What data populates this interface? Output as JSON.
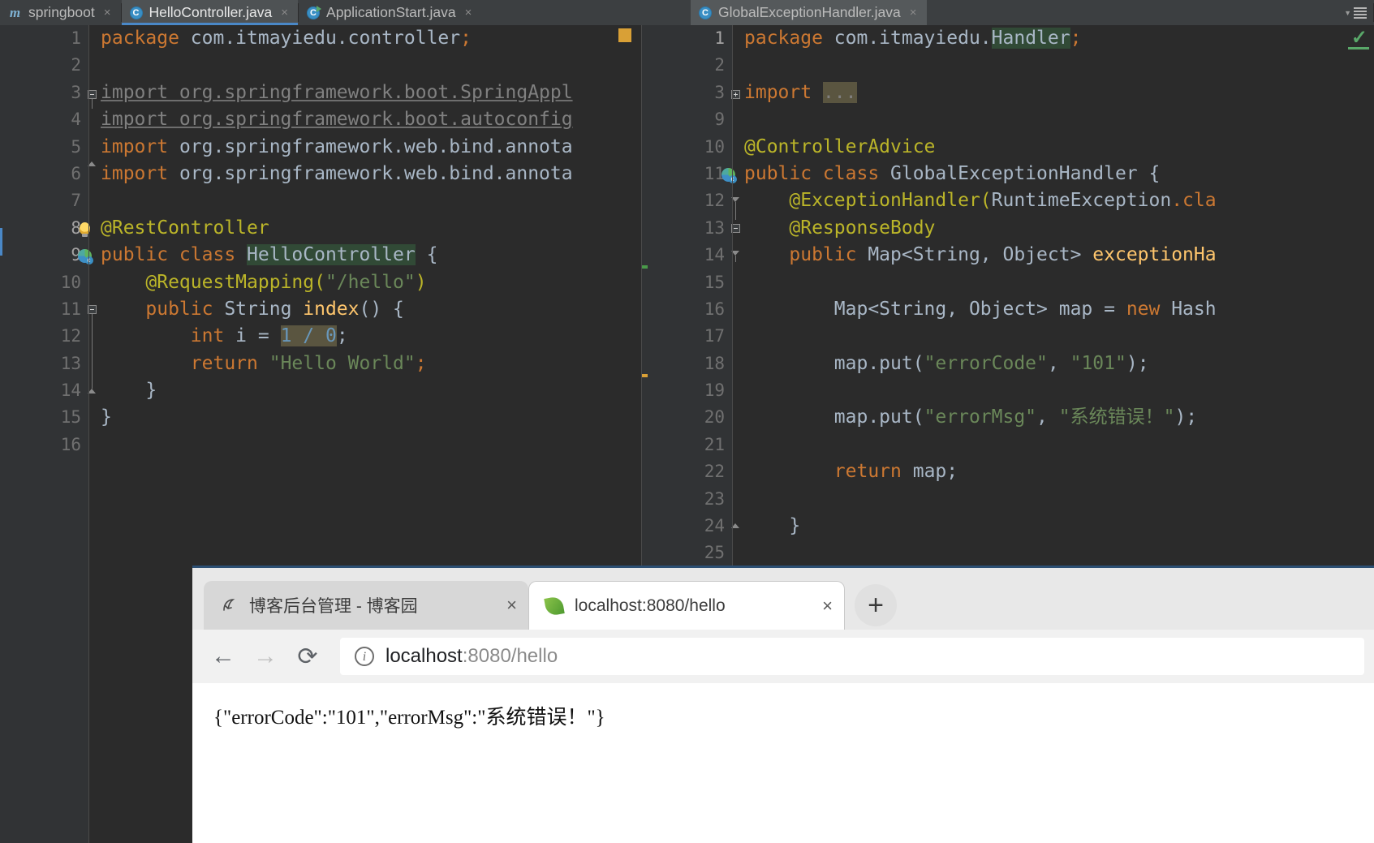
{
  "ide": {
    "tabs": [
      {
        "label": "springboot",
        "icon": "maven-module-icon",
        "state": "normal"
      },
      {
        "label": "HelloController.java",
        "icon": "java-class-icon",
        "state": "active"
      },
      {
        "label": "ApplicationStart.java",
        "icon": "java-runnable-class-icon",
        "state": "normal"
      },
      {
        "label": "GlobalExceptionHandler.java",
        "icon": "java-class-icon",
        "state": "focused"
      }
    ],
    "tab_close_label": "×",
    "tabbar_overflow_icon": "tab-list-dropdown-icon",
    "left_editor": {
      "file": "HelloController.java",
      "line_numbers": [
        "1",
        "2",
        "3",
        "4",
        "5",
        "6",
        "7",
        "8",
        "9",
        "10",
        "11",
        "12",
        "13",
        "14",
        "15",
        "16"
      ],
      "lines": [
        {
          "n": "1",
          "tokens": [
            {
              "t": "package",
              "c": "k"
            },
            {
              "t": " com.itmayiedu.controller",
              "c": "id"
            },
            {
              "t": ";",
              "c": "k"
            }
          ]
        },
        {
          "n": "2",
          "tokens": []
        },
        {
          "n": "3",
          "tokens": [
            {
              "t": "import org.springframework.boot.SpringAppl",
              "c": "unused"
            }
          ]
        },
        {
          "n": "4",
          "tokens": [
            {
              "t": "import org.springframework.boot.autoconfig",
              "c": "unused"
            }
          ]
        },
        {
          "n": "5",
          "tokens": [
            {
              "t": "import",
              "c": "k"
            },
            {
              "t": " org.springframework.web.bind.annota",
              "c": "id"
            }
          ]
        },
        {
          "n": "6",
          "tokens": [
            {
              "t": "import",
              "c": "k"
            },
            {
              "t": " org.springframework.web.bind.annota",
              "c": "id"
            }
          ]
        },
        {
          "n": "7",
          "tokens": []
        },
        {
          "n": "8",
          "tokens": [
            {
              "t": "@RestController",
              "c": "an"
            }
          ]
        },
        {
          "n": "9",
          "tokens": [
            {
              "t": "public class ",
              "c": "k"
            },
            {
              "t": "HelloController",
              "c": "id sel-green"
            },
            {
              "t": " {",
              "c": "id"
            }
          ]
        },
        {
          "n": "10",
          "tokens": [
            {
              "t": "    @RequestMapping(",
              "c": "an"
            },
            {
              "t": "\"/hello\"",
              "c": "s"
            },
            {
              "t": ")",
              "c": "an"
            }
          ]
        },
        {
          "n": "11",
          "tokens": [
            {
              "t": "    public ",
              "c": "k"
            },
            {
              "t": "String ",
              "c": "id"
            },
            {
              "t": "index",
              "c": "mth"
            },
            {
              "t": "() {",
              "c": "id"
            }
          ]
        },
        {
          "n": "12",
          "tokens": [
            {
              "t": "        int ",
              "c": "k"
            },
            {
              "t": "i",
              "c": "id"
            },
            {
              "t": " = ",
              "c": "id"
            },
            {
              "t": "1 / 0",
              "c": "num hl-box"
            },
            {
              "t": ";",
              "c": "id"
            }
          ]
        },
        {
          "n": "13",
          "tokens": [
            {
              "t": "        return ",
              "c": "k"
            },
            {
              "t": "\"Hello World\"",
              "c": "s"
            },
            {
              "t": ";",
              "c": "k"
            }
          ]
        },
        {
          "n": "14",
          "tokens": [
            {
              "t": "    }",
              "c": "id"
            }
          ]
        },
        {
          "n": "15",
          "tokens": [
            {
              "t": "}",
              "c": "id"
            }
          ]
        },
        {
          "n": "16",
          "tokens": []
        }
      ],
      "gutter_icons": [
        {
          "line": "8",
          "icon": "intention-bulb-icon"
        },
        {
          "line": "9",
          "icon": "spring-bean-icon"
        }
      ],
      "bookmark_marker": "bookmark-square-marker"
    },
    "right_editor": {
      "file": "GlobalExceptionHandler.java",
      "analysis_status_icon": "inspection-ok-check-icon",
      "lines": [
        {
          "n": "1",
          "tokens": [
            {
              "t": "package",
              "c": "k"
            },
            {
              "t": " com.itmayiedu.",
              "c": "id"
            },
            {
              "t": "Handler",
              "c": "id sel-green"
            },
            {
              "t": ";",
              "c": "k"
            }
          ]
        },
        {
          "n": "2",
          "tokens": []
        },
        {
          "n": "3",
          "tokens": [
            {
              "t": "import",
              "c": "k"
            },
            {
              "t": " ",
              "c": "id"
            },
            {
              "t": "...",
              "c": "gray hl-box"
            }
          ]
        },
        {
          "n": "9",
          "tokens": []
        },
        {
          "n": "10",
          "tokens": [
            {
              "t": "@ControllerAdvice",
              "c": "an"
            }
          ]
        },
        {
          "n": "11",
          "tokens": [
            {
              "t": "public class ",
              "c": "k"
            },
            {
              "t": "GlobalExceptionHandler {",
              "c": "id"
            }
          ]
        },
        {
          "n": "12",
          "tokens": [
            {
              "t": "    @ExceptionHandler(",
              "c": "an"
            },
            {
              "t": "RuntimeException",
              "c": "id"
            },
            {
              "t": ".cla",
              "c": "k"
            }
          ]
        },
        {
          "n": "13",
          "tokens": [
            {
              "t": "    @ResponseBody",
              "c": "an"
            }
          ]
        },
        {
          "n": "14",
          "tokens": [
            {
              "t": "    public ",
              "c": "k"
            },
            {
              "t": "Map<String, Object> ",
              "c": "id"
            },
            {
              "t": "exceptionHa",
              "c": "mth"
            }
          ]
        },
        {
          "n": "15",
          "tokens": []
        },
        {
          "n": "16",
          "tokens": [
            {
              "t": "        Map<String, Object> map = ",
              "c": "id"
            },
            {
              "t": "new ",
              "c": "k"
            },
            {
              "t": "Hash",
              "c": "id"
            }
          ]
        },
        {
          "n": "17",
          "tokens": []
        },
        {
          "n": "18",
          "tokens": [
            {
              "t": "        map.put(",
              "c": "id"
            },
            {
              "t": "\"errorCode\"",
              "c": "s"
            },
            {
              "t": ", ",
              "c": "id"
            },
            {
              "t": "\"101\"",
              "c": "s"
            },
            {
              "t": ");",
              "c": "id"
            }
          ]
        },
        {
          "n": "19",
          "tokens": []
        },
        {
          "n": "20",
          "tokens": [
            {
              "t": "        map.put(",
              "c": "id"
            },
            {
              "t": "\"errorMsg\"",
              "c": "s"
            },
            {
              "t": ", ",
              "c": "id"
            },
            {
              "t": "\"系统错误！\"",
              "c": "s"
            },
            {
              "t": ");",
              "c": "id"
            }
          ]
        },
        {
          "n": "21",
          "tokens": []
        },
        {
          "n": "22",
          "tokens": [
            {
              "t": "        return ",
              "c": "k"
            },
            {
              "t": "map;",
              "c": "id"
            }
          ]
        },
        {
          "n": "23",
          "tokens": []
        },
        {
          "n": "24",
          "tokens": [
            {
              "t": "    }",
              "c": "id"
            }
          ]
        },
        {
          "n": "25",
          "tokens": []
        }
      ],
      "gutter_icons": [
        {
          "line": "11",
          "icon": "spring-bean-icon"
        }
      ]
    }
  },
  "browser": {
    "tabs": [
      {
        "title": "博客后台管理 - 博客园",
        "favicon": "cnblogs-favicon",
        "active": false
      },
      {
        "title": "localhost:8080/hello",
        "favicon": "spring-leaf-favicon",
        "active": true
      }
    ],
    "tab_close_label": "×",
    "new_tab_label": "+",
    "nav": {
      "back_icon": "back-arrow-icon",
      "forward_icon": "forward-arrow-icon",
      "reload_icon": "reload-icon",
      "back_label": "←",
      "forward_label": "→",
      "reload_label": "⟳"
    },
    "omnibox": {
      "site_info_icon": "page-info-icon",
      "site_info_label": "i",
      "url_host": "localhost",
      "url_rest": ":8080/hello"
    },
    "page_content": "{\"errorCode\":\"101\",\"errorMsg\":\"系统错误！\"}"
  }
}
